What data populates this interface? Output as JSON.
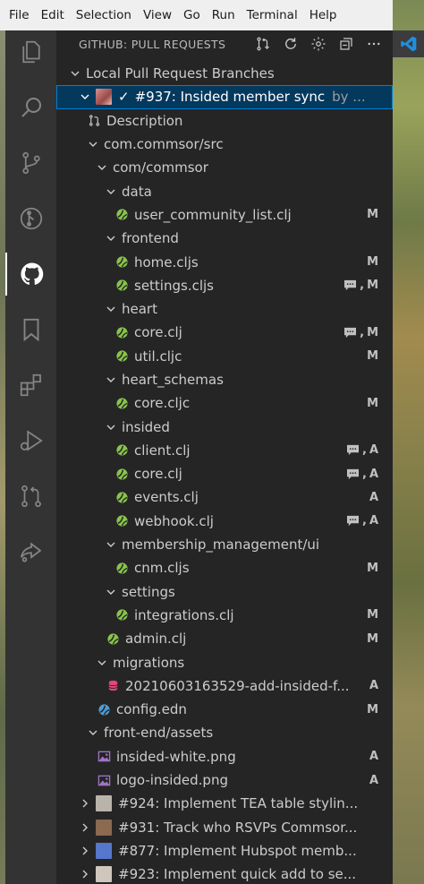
{
  "menubar": [
    "File",
    "Edit",
    "Selection",
    "View",
    "Go",
    "Run",
    "Terminal",
    "Help"
  ],
  "sidebar": {
    "title": "GITHUB: PULL REQUESTS",
    "actions": [
      "create-pull-request-icon",
      "refresh-icon",
      "gear-icon",
      "collapse-all-icon",
      "more-icon"
    ]
  },
  "tree": {
    "root_label": "Local Pull Request Branches",
    "pr_selected": {
      "check": "✓",
      "title": "#937: Insided member sync",
      "author": "by ..."
    },
    "description": "Description",
    "rows": [
      {
        "label": "com.commsor/src",
        "type": "folder",
        "depth": 2
      },
      {
        "label": "com/commsor",
        "type": "folder",
        "depth": 3
      },
      {
        "label": "data",
        "type": "folder",
        "depth": 4
      },
      {
        "label": "user_community_list.clj",
        "type": "clj",
        "depth": 5,
        "status": "M",
        "comments": false
      },
      {
        "label": "frontend",
        "type": "folder",
        "depth": 4
      },
      {
        "label": "home.cljs",
        "type": "clj",
        "depth": 5,
        "status": "M",
        "comments": false
      },
      {
        "label": "settings.cljs",
        "type": "clj",
        "depth": 5,
        "status": "M",
        "comments": true
      },
      {
        "label": "heart",
        "type": "folder",
        "depth": 4
      },
      {
        "label": "core.clj",
        "type": "clj",
        "depth": 5,
        "status": "M",
        "comments": true
      },
      {
        "label": "util.cljc",
        "type": "clj",
        "depth": 5,
        "status": "M",
        "comments": false
      },
      {
        "label": "heart_schemas",
        "type": "folder",
        "depth": 4
      },
      {
        "label": "core.cljc",
        "type": "clj",
        "depth": 5,
        "status": "M",
        "comments": false
      },
      {
        "label": "insided",
        "type": "folder",
        "depth": 4
      },
      {
        "label": "client.clj",
        "type": "clj",
        "depth": 5,
        "status": "A",
        "comments": true
      },
      {
        "label": "core.clj",
        "type": "clj",
        "depth": 5,
        "status": "A",
        "comments": true
      },
      {
        "label": "events.clj",
        "type": "clj",
        "depth": 5,
        "status": "A",
        "comments": false
      },
      {
        "label": "webhook.clj",
        "type": "clj",
        "depth": 5,
        "status": "A",
        "comments": true
      },
      {
        "label": "membership_management/ui",
        "type": "folder",
        "depth": 4
      },
      {
        "label": "cnm.cljs",
        "type": "clj",
        "depth": 5,
        "status": "M",
        "comments": false
      },
      {
        "label": "settings",
        "type": "folder",
        "depth": 4
      },
      {
        "label": "integrations.clj",
        "type": "clj",
        "depth": 5,
        "status": "M",
        "comments": false
      },
      {
        "label": "admin.clj",
        "type": "clj",
        "depth": 4,
        "status": "M",
        "comments": false
      },
      {
        "label": "migrations",
        "type": "folder",
        "depth": 3
      },
      {
        "label": "20210603163529-add-insided-f...",
        "type": "sql",
        "depth": 4,
        "status": "A",
        "comments": false
      },
      {
        "label": "config.edn",
        "type": "edn",
        "depth": 3,
        "status": "M",
        "comments": false
      },
      {
        "label": "front-end/assets",
        "type": "folder",
        "depth": 2
      },
      {
        "label": "insided-white.png",
        "type": "png",
        "depth": 3,
        "status": "A",
        "comments": false
      },
      {
        "label": "logo-insided.png",
        "type": "png",
        "depth": 3,
        "status": "A",
        "comments": false
      }
    ],
    "other_prs": [
      {
        "title": "#924: Implement TEA table stylin...",
        "avatar": "#b9b4aa"
      },
      {
        "title": "#931: Track who RSVPs Commsor...",
        "avatar": "#8a6a50"
      },
      {
        "title": "#877: Implement Hubspot memb...",
        "avatar": "#5577cc"
      },
      {
        "title": "#923: Implement quick add to se...",
        "avatar": "#cfc7bb"
      }
    ]
  },
  "colors": {
    "accent_blue": "#007fd4",
    "selection_bg": "#04395e",
    "clj_green": "#88c34a",
    "sql_pink": "#e2467b",
    "edn_blue": "#4e9bd4",
    "png_purple": "#a074c4"
  }
}
